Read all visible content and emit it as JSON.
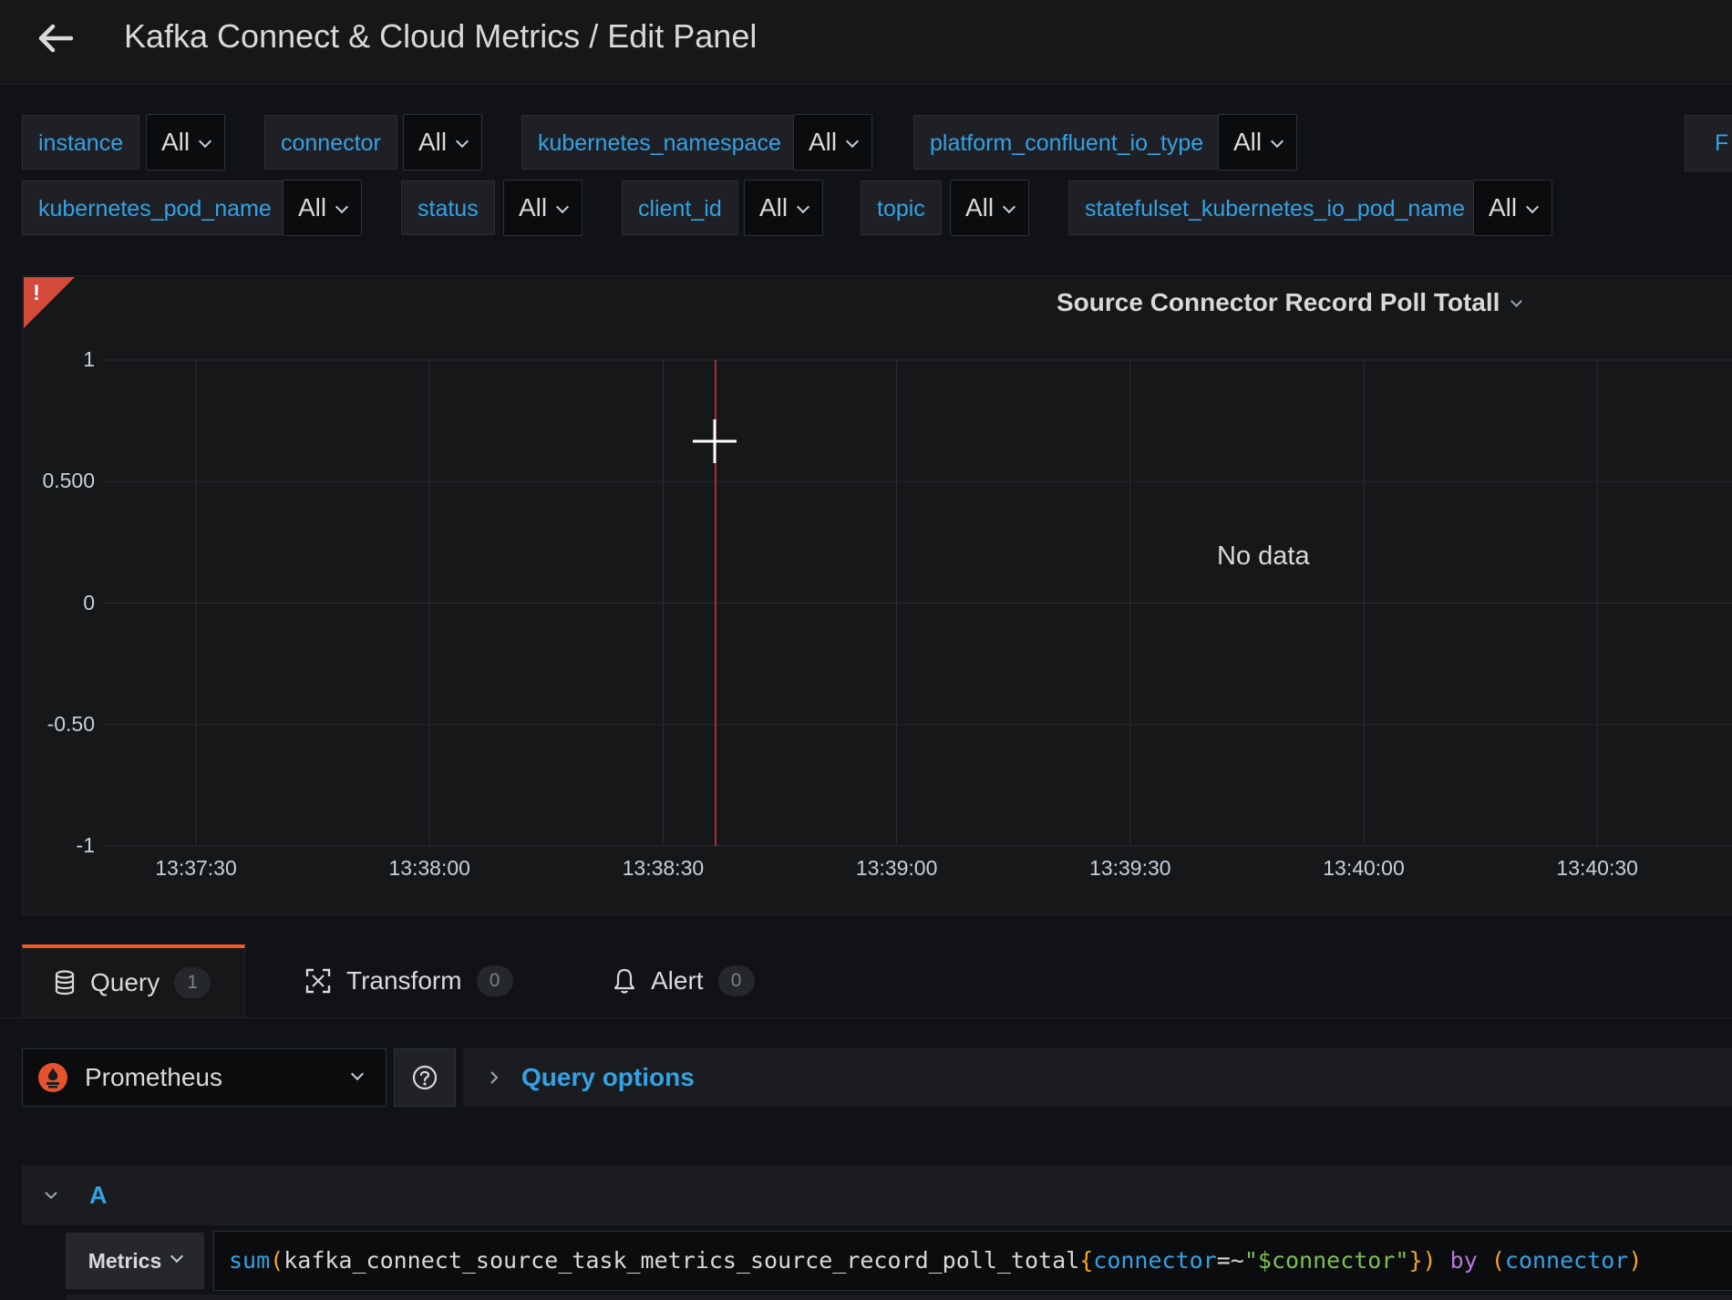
{
  "header": {
    "title": "Kafka Connect & Cloud Metrics / Edit Panel"
  },
  "variables": [
    {
      "label": "instance",
      "value": "All"
    },
    {
      "label": "connector",
      "value": "All"
    },
    {
      "label": "kubernetes_namespace",
      "value": "All"
    },
    {
      "label": "platform_confluent_io_type",
      "value": "All"
    },
    {
      "label": "kubernetes_pod_name",
      "value": "All"
    },
    {
      "label": "status",
      "value": "All"
    },
    {
      "label": "client_id",
      "value": "All"
    },
    {
      "label": "topic",
      "value": "All"
    },
    {
      "label": "statefulset_kubernetes_io_pod_name",
      "value": "All"
    }
  ],
  "variables_extra_label": "F",
  "panel": {
    "title": "Source Connector Record Poll Totall",
    "error_mark": "!",
    "no_data_text": "No data"
  },
  "chart_data": {
    "type": "line",
    "title": "Source Connector Record Poll Totall",
    "x_ticks": [
      "13:37:30",
      "13:38:00",
      "13:38:30",
      "13:39:00",
      "13:39:30",
      "13:40:00",
      "13:40:30"
    ],
    "y_ticks": [
      "1",
      "0.500",
      "0",
      "-0.50",
      "-1"
    ],
    "ylim": [
      -1,
      1
    ],
    "grid": true,
    "series": [],
    "annotation": "No data"
  },
  "tabs": [
    {
      "label": "Query",
      "count": "1",
      "icon": "database-icon",
      "active": true
    },
    {
      "label": "Transform",
      "count": "0",
      "icon": "transform-icon"
    },
    {
      "label": "Alert",
      "count": "0",
      "icon": "bell-icon"
    }
  ],
  "datasource": {
    "name": "Prometheus",
    "icon": "prometheus-icon"
  },
  "query_options_label": "Query options",
  "query": {
    "ref_id": "A",
    "editor_mode": "Metrics",
    "tokens": {
      "fn": "sum",
      "open_paren": "(",
      "metric": "kafka_connect_source_task_metrics_source_record_poll_total",
      "open_brace": "{",
      "label": "connector",
      "op": "=~",
      "value": "\"$connector\"",
      "close_brace": "}",
      "close_paren": ")",
      "by_kw": "by",
      "group_open": "(",
      "group_label": "connector",
      "group_close": ")"
    }
  },
  "colors": {
    "background": "#111217",
    "panel": "#161719",
    "accent_blue": "#33a2e5",
    "error_red": "#d44a3a",
    "active_tab": "#f05a28",
    "cursor_line": "#e02f44"
  }
}
